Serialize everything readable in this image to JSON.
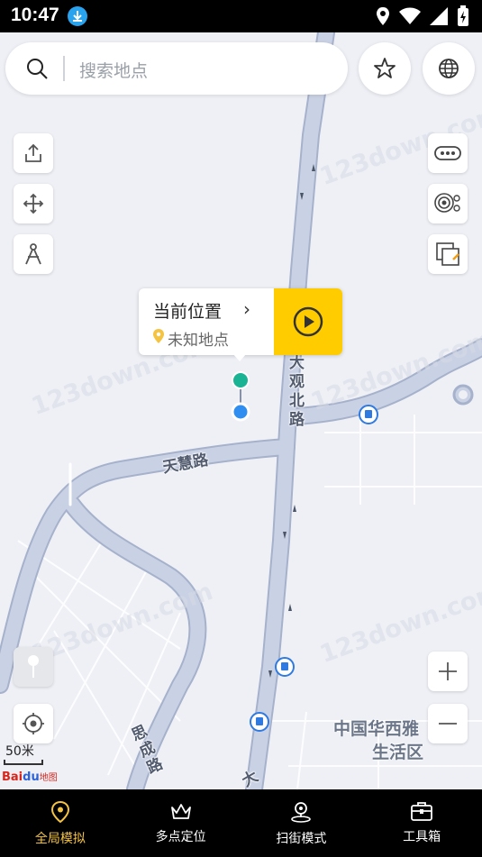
{
  "status_bar": {
    "time": "10:47"
  },
  "search": {
    "placeholder": "搜索地点"
  },
  "popup": {
    "title": "当前位置",
    "subtitle": "未知地点"
  },
  "map_labels": {
    "road_daguan": "大观北路",
    "road_tianhui": "天慧路",
    "road_sicheng": "思成路",
    "road_da": "大",
    "poi": "中国华西雅",
    "poi_line2": "生活区"
  },
  "scale": {
    "label": "50米"
  },
  "logo": {
    "bai": "Bai",
    "du": "du",
    "ditu": "地图"
  },
  "watermark": "123down.com",
  "tabs": [
    {
      "label": "全局模拟",
      "icon": "location-pin-icon",
      "active": true
    },
    {
      "label": "多点定位",
      "icon": "crown-icon",
      "active": false
    },
    {
      "label": "扫街模式",
      "icon": "map-marker-icon",
      "active": false
    },
    {
      "label": "工具箱",
      "icon": "toolbox-icon",
      "active": false
    }
  ],
  "colors": {
    "accent": "#f5c342",
    "play": "#ffcc00",
    "road": "#c9d1e4",
    "marker_green": "#1ab394",
    "marker_blue": "#2f8ef0"
  }
}
